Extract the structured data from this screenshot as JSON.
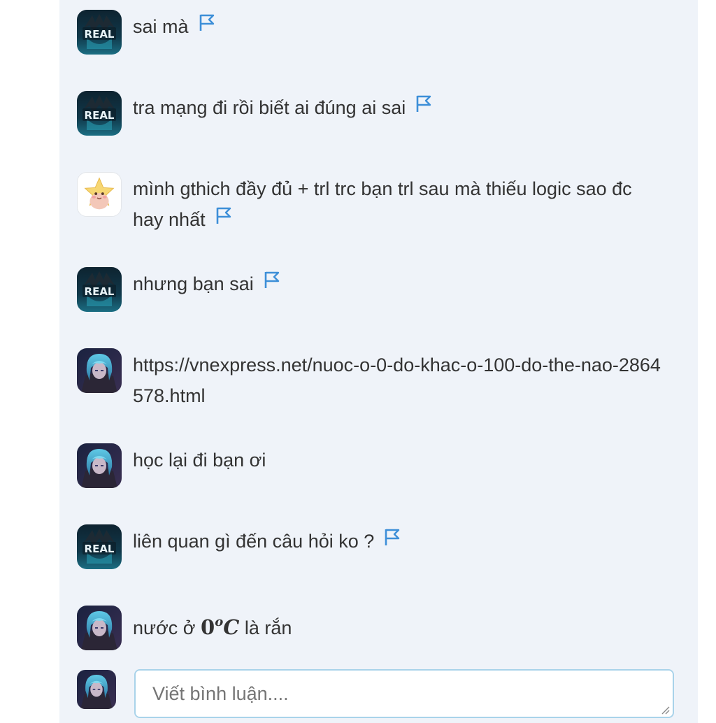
{
  "comments": [
    {
      "avatar": "real-logo-avatar",
      "text": "sai mà",
      "flag": true
    },
    {
      "avatar": "real-logo-avatar",
      "text": "tra mạng đi rồi biết ai đúng ai sai",
      "flag": true
    },
    {
      "avatar": "star-avatar",
      "text": "mình gthich đầy đủ + trl trc bạn trl sau mà thiếu logic sao đc hay nhất",
      "flag": true
    },
    {
      "avatar": "real-logo-avatar",
      "text": "nhưng bạn sai",
      "flag": true
    },
    {
      "avatar": "anime-character-avatar",
      "text": "https://vnexpress.net/nuoc-o-0-do-khac-o-100-do-the-nao-2864578.html",
      "flag": false
    },
    {
      "avatar": "anime-character-avatar",
      "text": "học lại đi bạn ơi",
      "flag": false
    },
    {
      "avatar": "real-logo-avatar",
      "text": "liên quan gì đến câu hỏi ko ?",
      "flag": true
    },
    {
      "avatar": "anime-character-avatar",
      "text_before": "nước ở",
      "math_number": "0",
      "math_superscript": "o",
      "math_unit": "C",
      "text_after": "là rắn",
      "flag": false
    }
  ],
  "avatar_labels": {
    "real_logo": "REAL"
  },
  "reply": {
    "avatar": "anime-character-avatar",
    "placeholder": "Viết bình luận...."
  },
  "colors": {
    "panel_bg": "#eff3f9",
    "flag": "#3d8fd8",
    "text": "#333333",
    "input_border": "#a9d3ea",
    "placeholder": "#9a9a9a"
  }
}
